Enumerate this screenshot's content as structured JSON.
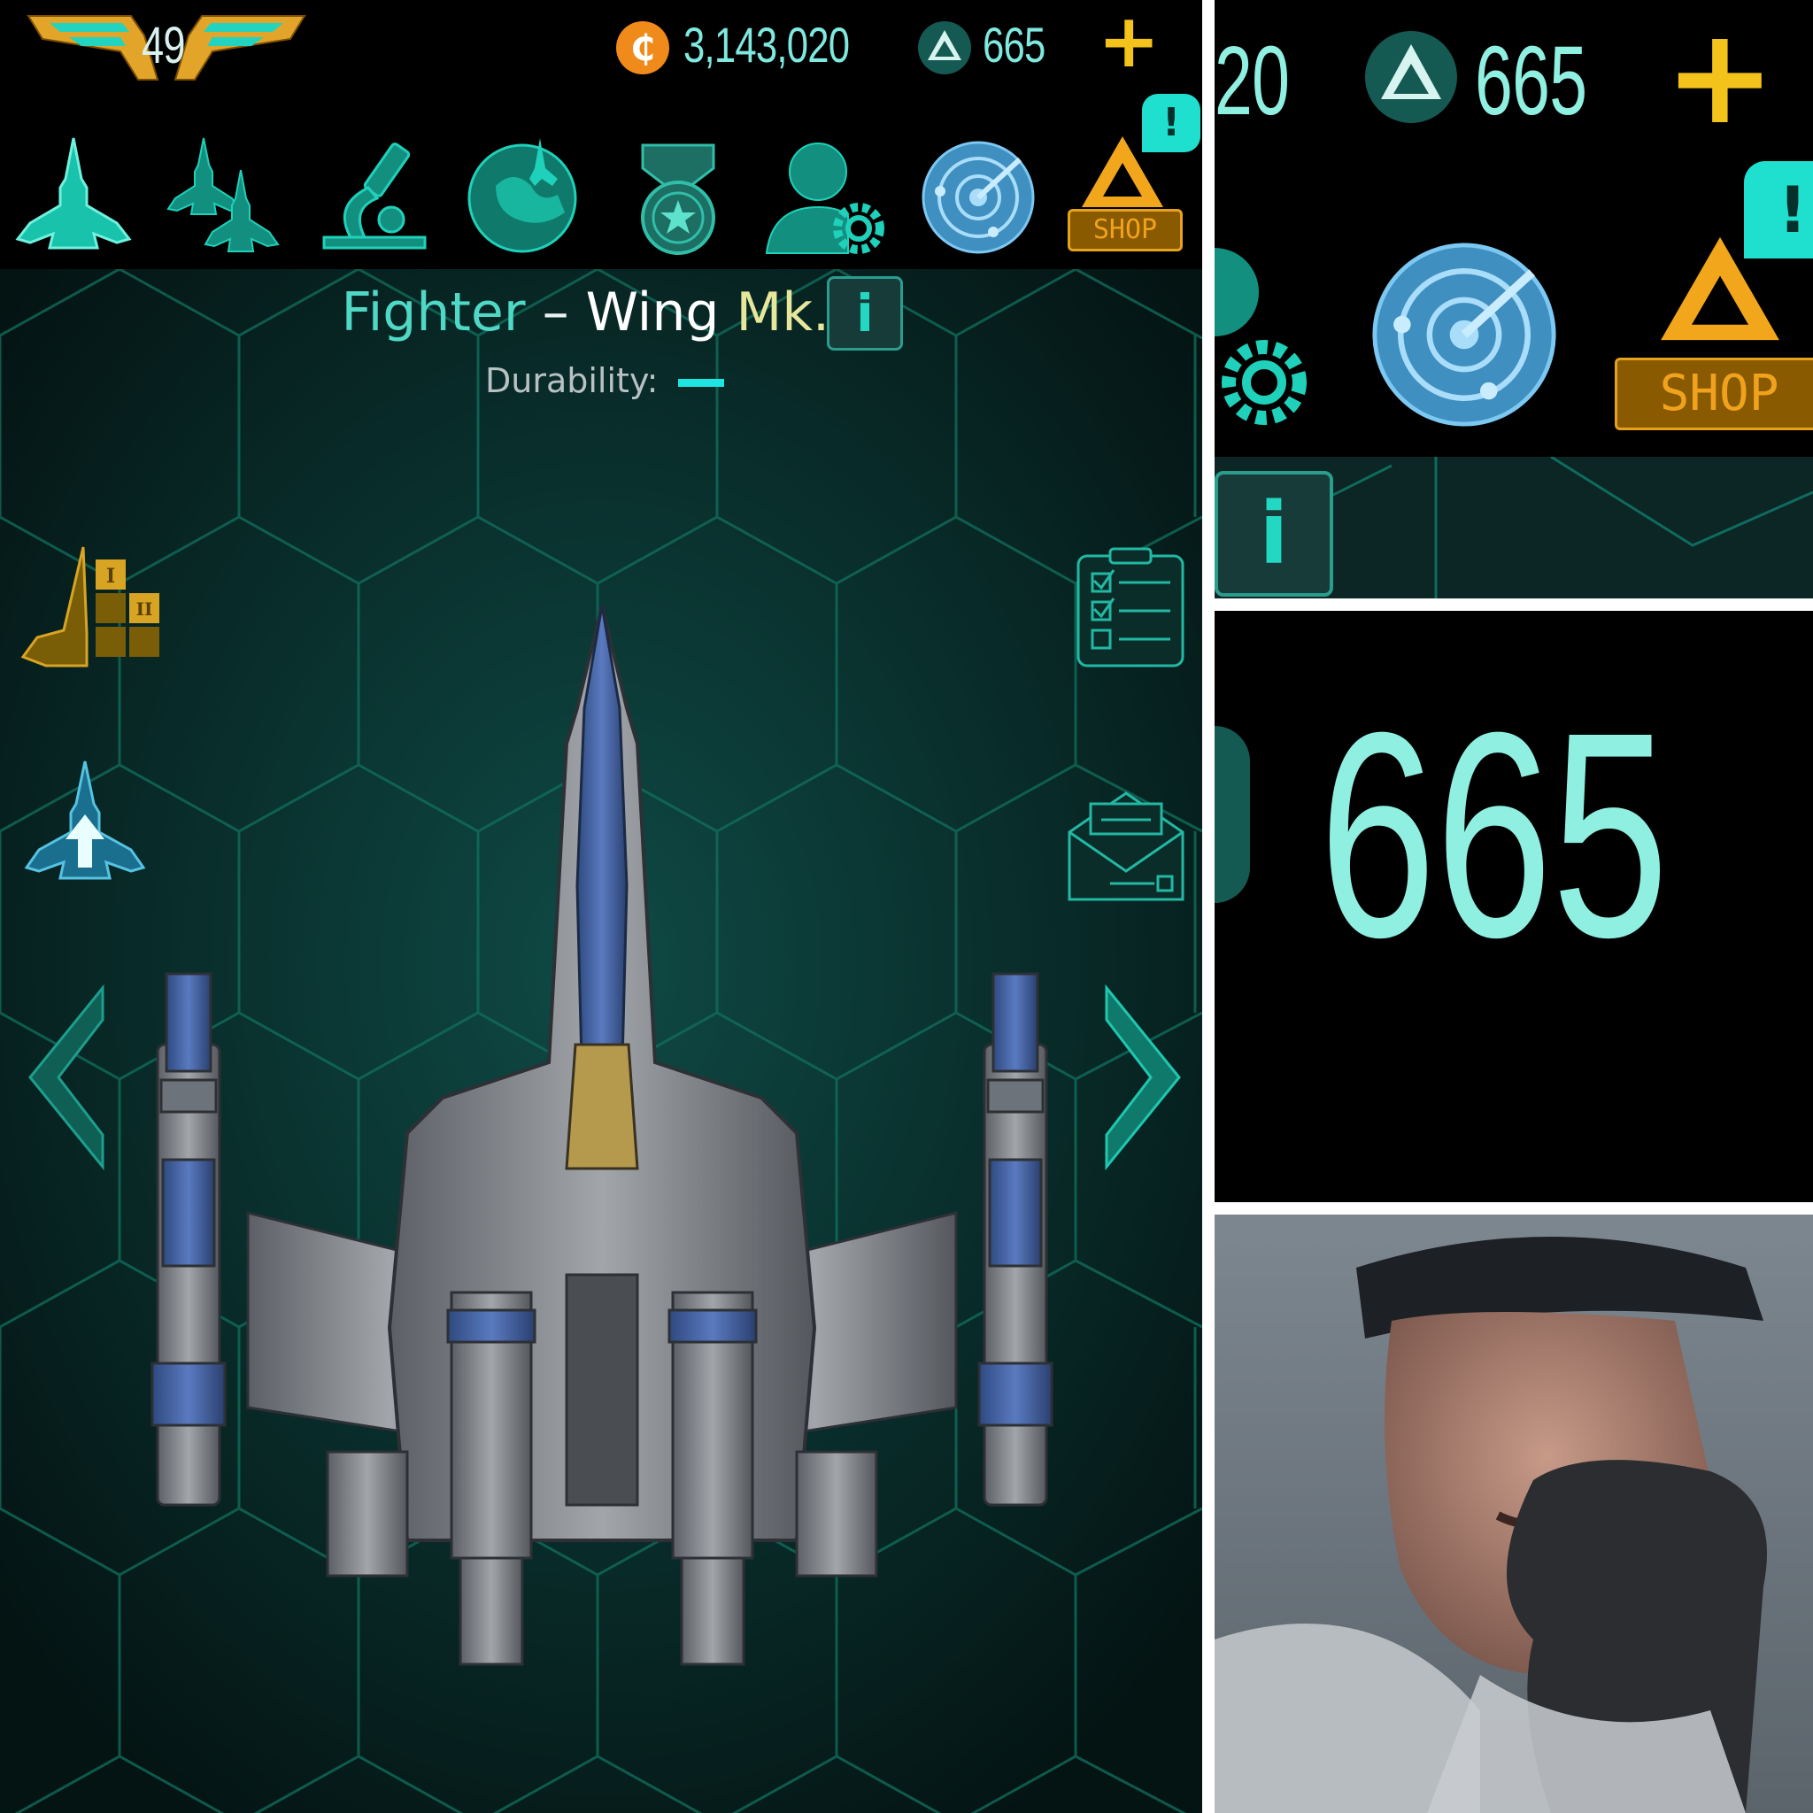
{
  "topbar": {
    "level": "49",
    "credits": "3,143,020",
    "gems": "665",
    "add_button": "+"
  },
  "nav": {
    "items": [
      {
        "icon": "fighter-ship-icon"
      },
      {
        "icon": "squadron-icon"
      },
      {
        "icon": "research-microscope-icon"
      },
      {
        "icon": "missions-planet-icon"
      },
      {
        "icon": "medal-icon"
      },
      {
        "icon": "profile-settings-icon"
      },
      {
        "icon": "radar-icon"
      },
      {
        "icon": "shop-icon",
        "label": "SHOP",
        "badge": "!"
      }
    ]
  },
  "ship": {
    "class": "Fighter",
    "separator": " – ",
    "name": "Wing",
    "mark": "Mk.II",
    "info_button": "i",
    "durability_label": "Durability:"
  },
  "side_buttons": {
    "left": [
      "ranking-icon",
      "upgrade-ship-icon"
    ],
    "right": [
      "checklist-icon",
      "mail-icon"
    ]
  },
  "arrows": {
    "prev": "chevron-left-icon",
    "next": "chevron-right-icon"
  },
  "zoom_top": {
    "credits_partial": "20",
    "gems": "665",
    "add_button": "+",
    "badge": "!",
    "shop_label": "SHOP",
    "info_button": "i"
  },
  "zoom_mid": {
    "gems": "665"
  },
  "colors": {
    "teal": "#1fb8a4",
    "text_teal": "#7fe9df",
    "gold": "#f2b51c",
    "mark_yellow": "#e6e79b",
    "radar_blue": "#5ab4e8"
  }
}
